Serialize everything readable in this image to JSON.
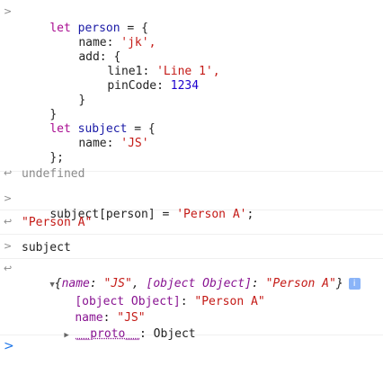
{
  "console": {
    "block1": {
      "l1": [
        "let",
        "person",
        "=",
        "{"
      ],
      "l2": [
        "name:",
        "'jk',"
      ],
      "l3": [
        "add:",
        "{"
      ],
      "l4": [
        "line1:",
        "'Line 1',"
      ],
      "l5": [
        "pinCode:",
        "1234"
      ],
      "l6": [
        "}"
      ],
      "l7": [
        "}"
      ],
      "l8": [
        "let",
        "subject",
        "=",
        "{"
      ],
      "l9": [
        "name:",
        "'JS'"
      ],
      "l10": [
        "};"
      ]
    },
    "undefined_text": "undefined",
    "cmd2": {
      "lhs": "subject[person]",
      "eq": "=",
      "rhs": "'Person A'",
      "semi": ";"
    },
    "ret2": "\"Person A\"",
    "cmd3": "subject",
    "obj": {
      "summary_open": "{",
      "summary_name_key": "name",
      "summary_name_val": "\"JS\"",
      "summary_comma": ",",
      "summary_obj_key": "[object Object]",
      "summary_obj_val": "\"Person A\"",
      "summary_close": "}",
      "info_icon": "i",
      "p1_key": "[object Object]",
      "p1_val": "\"Person A\"",
      "p2_key": "name",
      "p2_val": "\"JS\"",
      "proto_key": "__proto__",
      "proto_val": "Object"
    },
    "icons": {
      "input": "chevron-right-icon",
      "output": "return-arrow-icon",
      "expand": "triangle-down-icon",
      "collapse": "triangle-right-icon",
      "info": "info-icon"
    }
  }
}
